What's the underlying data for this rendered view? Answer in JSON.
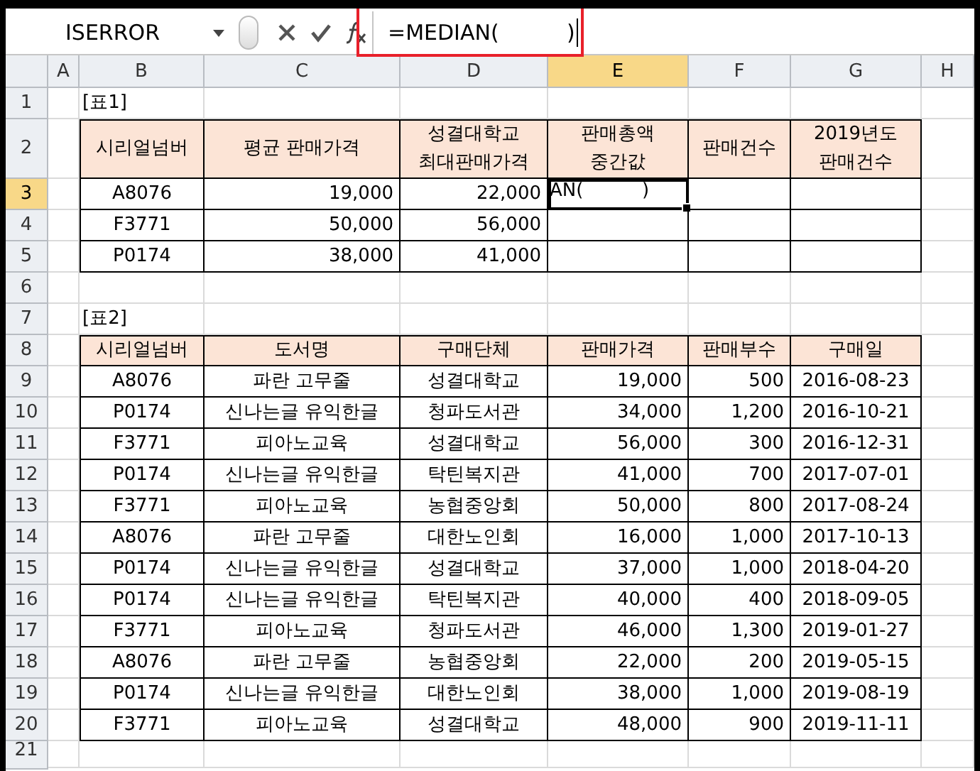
{
  "formula_bar": {
    "name_box": "ISERROR",
    "formula": "=MEDIAN(          )",
    "highlighted": true
  },
  "columns": [
    {
      "label": "A",
      "selected": false
    },
    {
      "label": "B",
      "selected": false
    },
    {
      "label": "C",
      "selected": false
    },
    {
      "label": "D",
      "selected": false
    },
    {
      "label": "E",
      "selected": true
    },
    {
      "label": "F",
      "selected": false
    },
    {
      "label": "G",
      "selected": false
    },
    {
      "label": "H",
      "selected": false
    }
  ],
  "rows": [
    {
      "number": "1",
      "selected": false,
      "kind": "title",
      "cells": {
        "B": "[표1]"
      }
    },
    {
      "number": "2",
      "selected": false,
      "kind": "header",
      "cells": {
        "B": "시리얼넘버",
        "C": "평균 판매가격",
        "D": "성결대학교\n최대판매가격",
        "E": "판매총액\n중간값",
        "F": "판매건수",
        "G": "2019년도\n판매건수"
      }
    },
    {
      "number": "3",
      "selected": true,
      "kind": "data",
      "cells": {
        "B": "A8076",
        "C": "19,000",
        "D": "22,000",
        "E": "AN(          )"
      }
    },
    {
      "number": "4",
      "selected": false,
      "kind": "data",
      "cells": {
        "B": "F3771",
        "C": "50,000",
        "D": "56,000"
      }
    },
    {
      "number": "5",
      "selected": false,
      "kind": "data",
      "cells": {
        "B": "P0174",
        "C": "38,000",
        "D": "41,000"
      }
    },
    {
      "number": "6",
      "selected": false,
      "kind": "blank"
    },
    {
      "number": "7",
      "selected": false,
      "kind": "title",
      "cells": {
        "B": "[표2]"
      }
    },
    {
      "number": "8",
      "selected": false,
      "kind": "header",
      "cells": {
        "B": "시리얼넘버",
        "C": "도서명",
        "D": "구매단체",
        "E": "판매가격",
        "F": "판매부수",
        "G": "구매일"
      }
    },
    {
      "number": "9",
      "selected": false,
      "kind": "data",
      "cells": {
        "B": "A8076",
        "C": "파란 고무줄",
        "D": "성결대학교",
        "E": "19,000",
        "F": "500",
        "G": "2016-08-23"
      }
    },
    {
      "number": "10",
      "selected": false,
      "kind": "data",
      "cells": {
        "B": "P0174",
        "C": "신나는글 유익한글",
        "D": "청파도서관",
        "E": "34,000",
        "F": "1,200",
        "G": "2016-10-21"
      }
    },
    {
      "number": "11",
      "selected": false,
      "kind": "data",
      "cells": {
        "B": "F3771",
        "C": "피아노교육",
        "D": "성결대학교",
        "E": "56,000",
        "F": "300",
        "G": "2016-12-31"
      }
    },
    {
      "number": "12",
      "selected": false,
      "kind": "data",
      "cells": {
        "B": "P0174",
        "C": "신나는글 유익한글",
        "D": "탁틴복지관",
        "E": "41,000",
        "F": "700",
        "G": "2017-07-01"
      }
    },
    {
      "number": "13",
      "selected": false,
      "kind": "data",
      "cells": {
        "B": "F3771",
        "C": "피아노교육",
        "D": "농협중앙회",
        "E": "50,000",
        "F": "800",
        "G": "2017-08-24"
      }
    },
    {
      "number": "14",
      "selected": false,
      "kind": "data",
      "cells": {
        "B": "A8076",
        "C": "파란 고무줄",
        "D": "대한노인회",
        "E": "16,000",
        "F": "1,000",
        "G": "2017-10-13"
      }
    },
    {
      "number": "15",
      "selected": false,
      "kind": "data",
      "cells": {
        "B": "P0174",
        "C": "신나는글 유익한글",
        "D": "성결대학교",
        "E": "37,000",
        "F": "1,000",
        "G": "2018-04-20"
      }
    },
    {
      "number": "16",
      "selected": false,
      "kind": "data",
      "cells": {
        "B": "P0174",
        "C": "신나는글 유익한글",
        "D": "탁틴복지관",
        "E": "40,000",
        "F": "400",
        "G": "2018-09-05"
      }
    },
    {
      "number": "17",
      "selected": false,
      "kind": "data",
      "cells": {
        "B": "F3771",
        "C": "피아노교육",
        "D": "청파도서관",
        "E": "46,000",
        "F": "1,300",
        "G": "2019-01-27"
      }
    },
    {
      "number": "18",
      "selected": false,
      "kind": "data",
      "cells": {
        "B": "A8076",
        "C": "파란 고무줄",
        "D": "농협중앙회",
        "E": "22,000",
        "F": "200",
        "G": "2019-05-15"
      }
    },
    {
      "number": "19",
      "selected": false,
      "kind": "data",
      "cells": {
        "B": "P0174",
        "C": "신나는글 유익한글",
        "D": "대한노인회",
        "E": "38,000",
        "F": "1,000",
        "G": "2019-08-19"
      }
    },
    {
      "number": "20",
      "selected": false,
      "kind": "data",
      "cells": {
        "B": "F3771",
        "C": "피아노교육",
        "D": "성결대학교",
        "E": "48,000",
        "F": "900",
        "G": "2019-11-11"
      }
    },
    {
      "number": "21",
      "selected": false,
      "kind": "blank"
    }
  ]
}
